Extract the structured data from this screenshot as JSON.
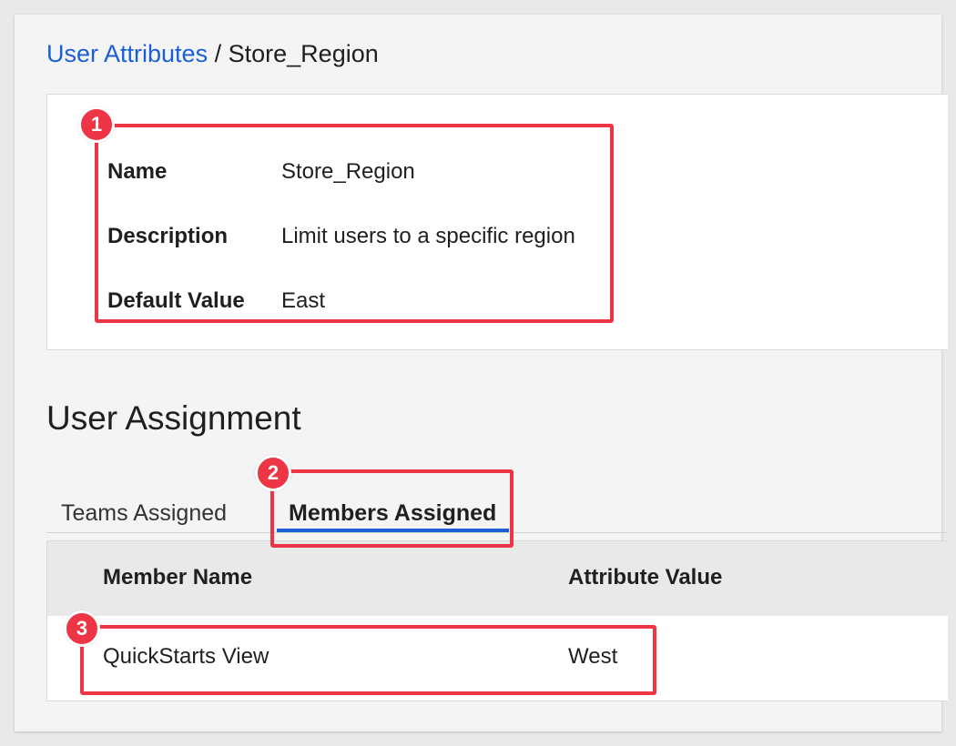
{
  "breadcrumb": {
    "parent_link": "User Attributes",
    "separator": "/",
    "current": "Store_Region"
  },
  "details": {
    "rows": [
      {
        "label": "Name",
        "value": "Store_Region"
      },
      {
        "label": "Description",
        "value": "Limit users to a specific region"
      },
      {
        "label": "Default Value",
        "value": "East"
      }
    ]
  },
  "user_assignment": {
    "title": "User Assignment",
    "tabs": [
      {
        "label": "Teams Assigned",
        "active": false
      },
      {
        "label": "Members Assigned",
        "active": true
      }
    ],
    "table": {
      "columns": [
        "Member Name",
        "Attribute Value"
      ],
      "rows": [
        {
          "member_name": "QuickStarts View",
          "attribute_value": "West"
        }
      ]
    }
  },
  "callouts": [
    "1",
    "2",
    "3"
  ],
  "colors": {
    "link": "#1a5fd6",
    "active_tab_underline": "#1a5fd6",
    "callout": "#ee3546"
  }
}
